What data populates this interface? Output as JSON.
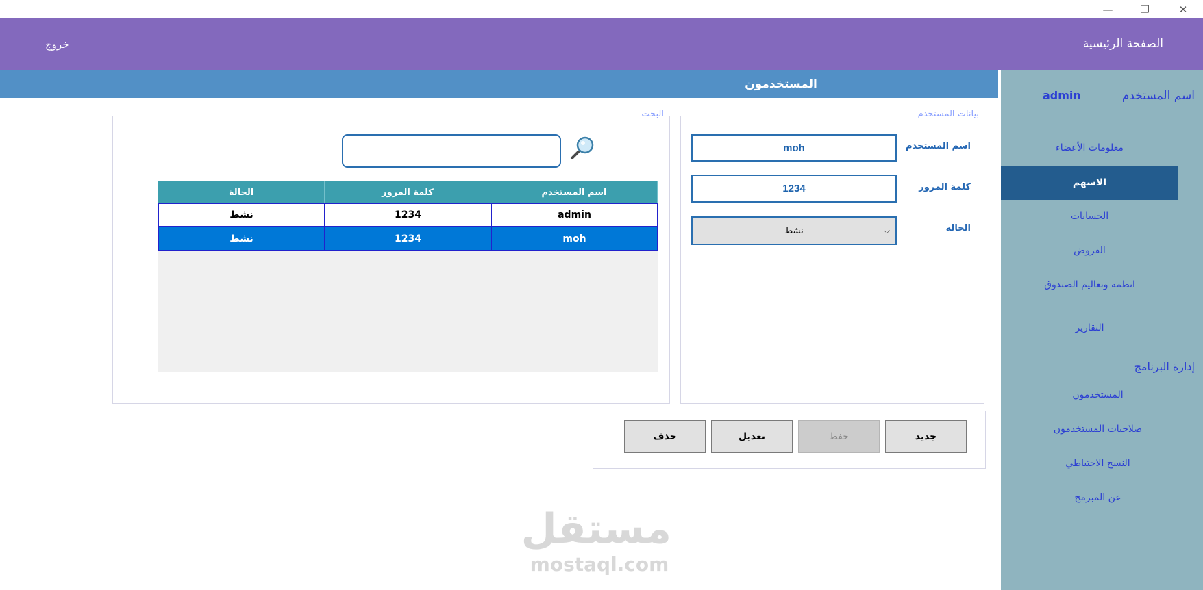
{
  "window": {
    "minimize_glyph": "—",
    "restore_glyph": "❐",
    "close_glyph": "✕"
  },
  "topbar": {
    "home": "الصفحة الرئيسية",
    "exit": "خروج"
  },
  "page": {
    "title": "المستخدمون"
  },
  "sidebar": {
    "user_label": "اسم المستخدم",
    "user_value": "admin",
    "items": [
      "معلومات الأعضاء",
      "الاسهم",
      "الحسابات",
      "القروض",
      "انظمة وتعاليم الصندوق",
      "التقارير"
    ],
    "active_index": 1,
    "section_title": "إدارة البرنامج",
    "admin_items": [
      "المستخدمون",
      "صلاحيات المستخدمون",
      "النسخ الاحتياطي",
      "عن المبرمج"
    ]
  },
  "user_form": {
    "group_label": "بيانات المستخدم",
    "username_label": "اسم المستخدم",
    "username_value": "moh",
    "password_label": "كلمة المرور",
    "password_value": "1234",
    "status_label": "الحاله",
    "status_value": "نشط"
  },
  "search": {
    "group_label": "البحث",
    "value": ""
  },
  "grid": {
    "columns": [
      "اسم المستخدم",
      "كلمة المرور",
      "الحالة"
    ],
    "rows": [
      {
        "cells": [
          "admin",
          "1234",
          "نشط"
        ]
      },
      {
        "cells": [
          "moh",
          "1234",
          "نشط"
        ]
      }
    ],
    "selected_index": 1
  },
  "buttons": {
    "new": "جديد",
    "save": "حفظ",
    "edit": "تعديل",
    "delete": "حذف"
  },
  "watermark": {
    "arabic": "مستقل",
    "english": "mostaql.com"
  },
  "colors": {
    "topbar": "#8369bd",
    "header": "#5290c6",
    "sidebar": "#8fb4bf",
    "sidebar_active": "#235c8e",
    "grid_header": "#3c9fae",
    "selected_row": "#0078d7"
  }
}
